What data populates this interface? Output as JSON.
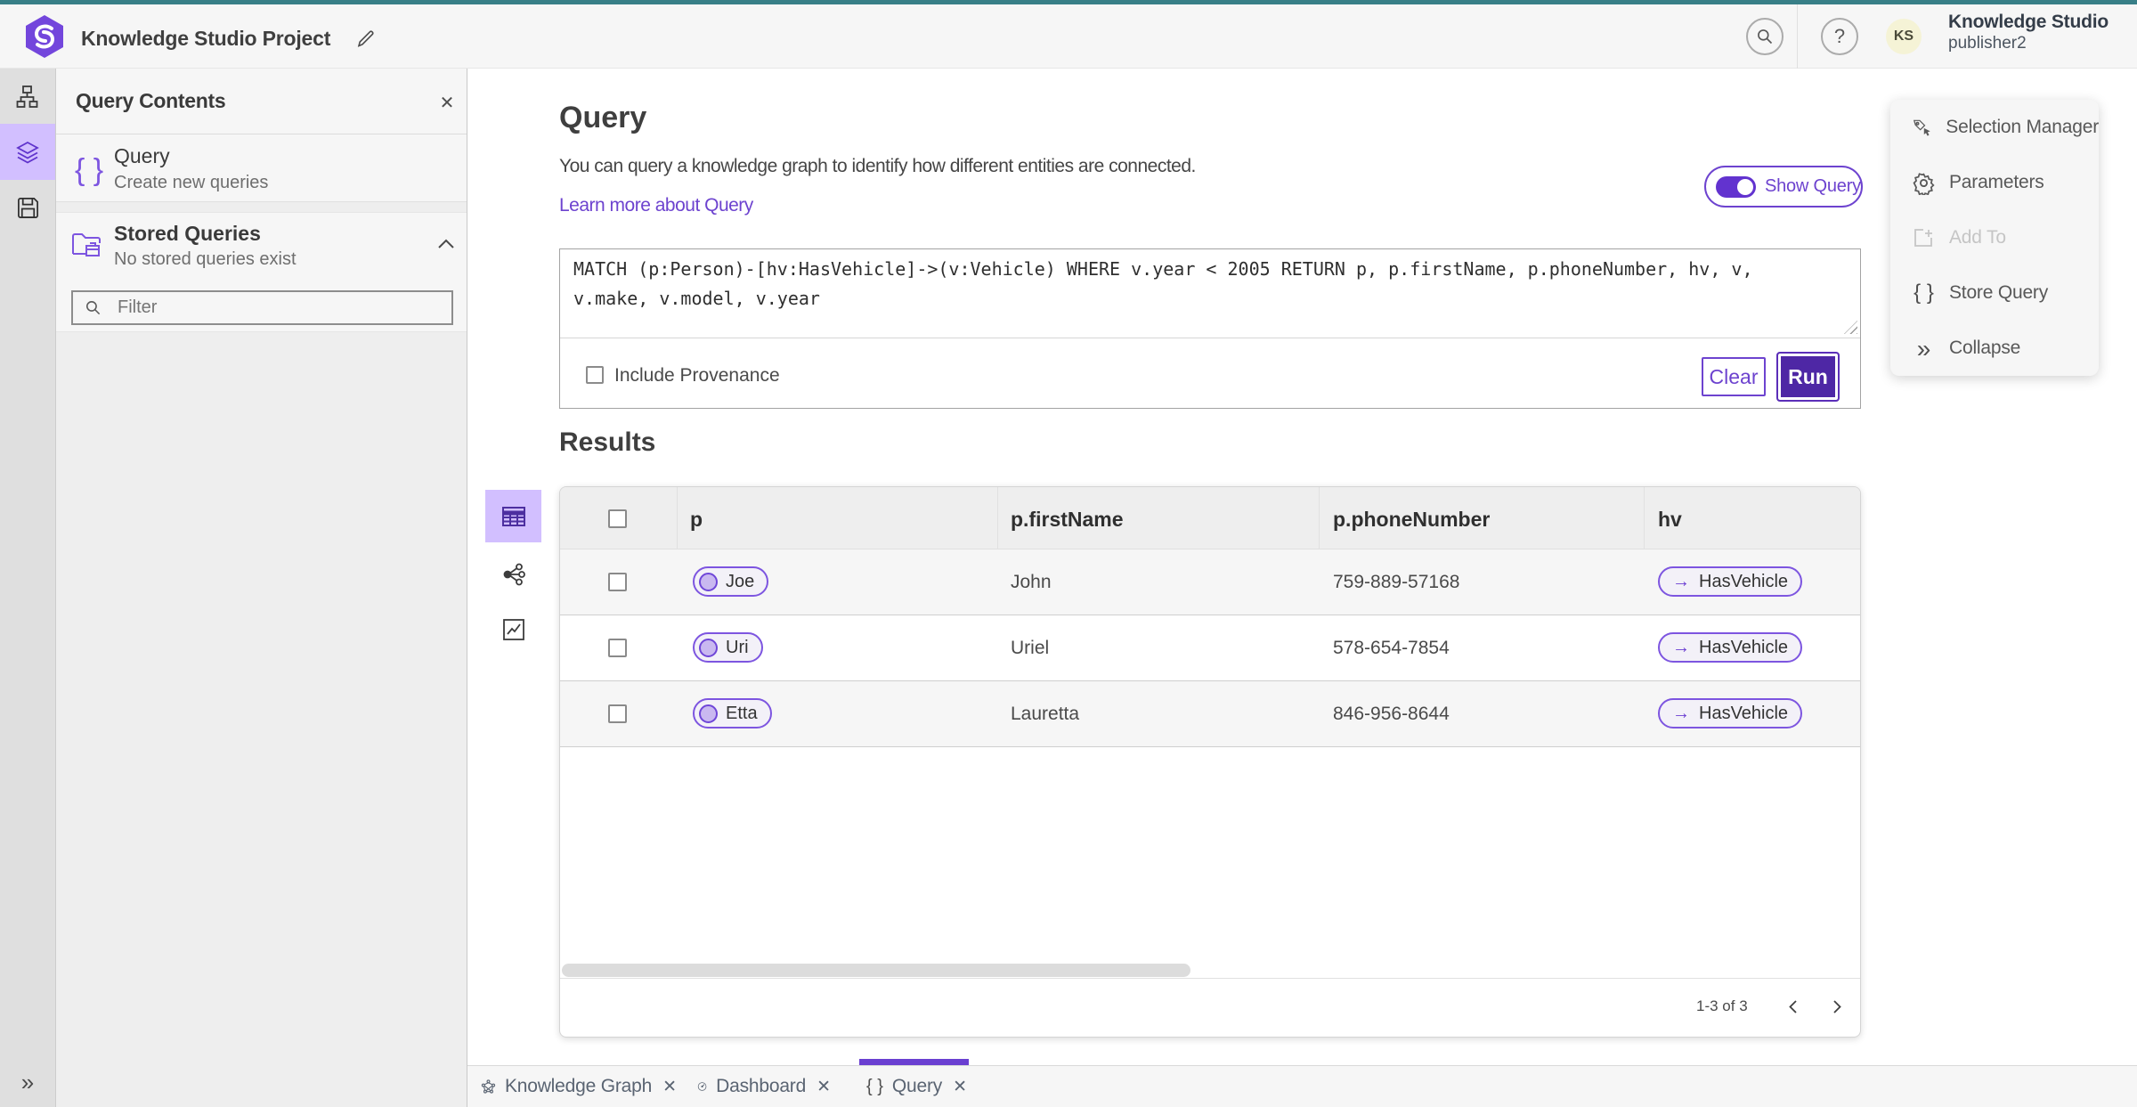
{
  "header": {
    "app_title": "Knowledge Studio Project",
    "account_name": "Knowledge Studio",
    "account_user": "publisher2",
    "avatar_initials": "KS",
    "help_glyph": "?"
  },
  "left_panel": {
    "title": "Query Contents",
    "close_glyph": "✕",
    "query_item": {
      "title": "Query",
      "subtitle": "Create new queries"
    },
    "stored_queries": {
      "title": "Stored Queries",
      "subtitle": "No stored queries exist"
    },
    "filter_placeholder": "Filter"
  },
  "query_section": {
    "title": "Query",
    "description": "You can query a knowledge graph to identify how different entities are connected.",
    "learn_more": "Learn more about Query",
    "show_query_label": "Show Query",
    "query_text": "MATCH (p:Person)-[hv:HasVehicle]->(v:Vehicle) WHERE v.year < 2005 RETURN p, p.firstName, p.phoneNumber, hv, v, v.make, v.model, v.year",
    "include_provenance_label": "Include Provenance",
    "clear_label": "Clear",
    "run_label": "Run"
  },
  "results": {
    "title": "Results",
    "columns": [
      "p",
      "p.firstName",
      "p.phoneNumber",
      "hv"
    ],
    "rows": [
      {
        "p": "Joe",
        "firstName": "John",
        "phone": "759-889-57168",
        "hv": "HasVehicle"
      },
      {
        "p": "Uri",
        "firstName": "Uriel",
        "phone": "578-654-7854",
        "hv": "HasVehicle"
      },
      {
        "p": "Etta",
        "firstName": "Lauretta",
        "phone": "846-956-8644",
        "hv": "HasVehicle"
      }
    ],
    "pagination": "1-3 of 3",
    "arrow_glyph": "→"
  },
  "context_menu": {
    "items": [
      {
        "label": "Selection Manager",
        "disabled": false
      },
      {
        "label": "Parameters",
        "disabled": false
      },
      {
        "label": "Add To",
        "disabled": true
      },
      {
        "label": "Store Query",
        "disabled": false
      },
      {
        "label": "Collapse",
        "disabled": false
      }
    ],
    "braces_glyph": "{ }",
    "collapse_glyph": "»"
  },
  "tabs": [
    {
      "label": "Knowledge Graph",
      "active": false
    },
    {
      "label": "Dashboard",
      "active": false
    },
    {
      "label": "Query",
      "active": true
    }
  ],
  "rail": {
    "expand_glyph": "»",
    "braces_glyph": "{ }"
  },
  "tab_close_glyph": "✕",
  "colors": {
    "top_accent": "#387f87",
    "brand_purple": "#7346dc",
    "accent_purple": "#6d43cf",
    "run_button": "#4e27a5",
    "selection_highlight": "#d2bfff",
    "pill_bg": "#f3f1f8",
    "avatar_bg": "#f5f3d6"
  }
}
